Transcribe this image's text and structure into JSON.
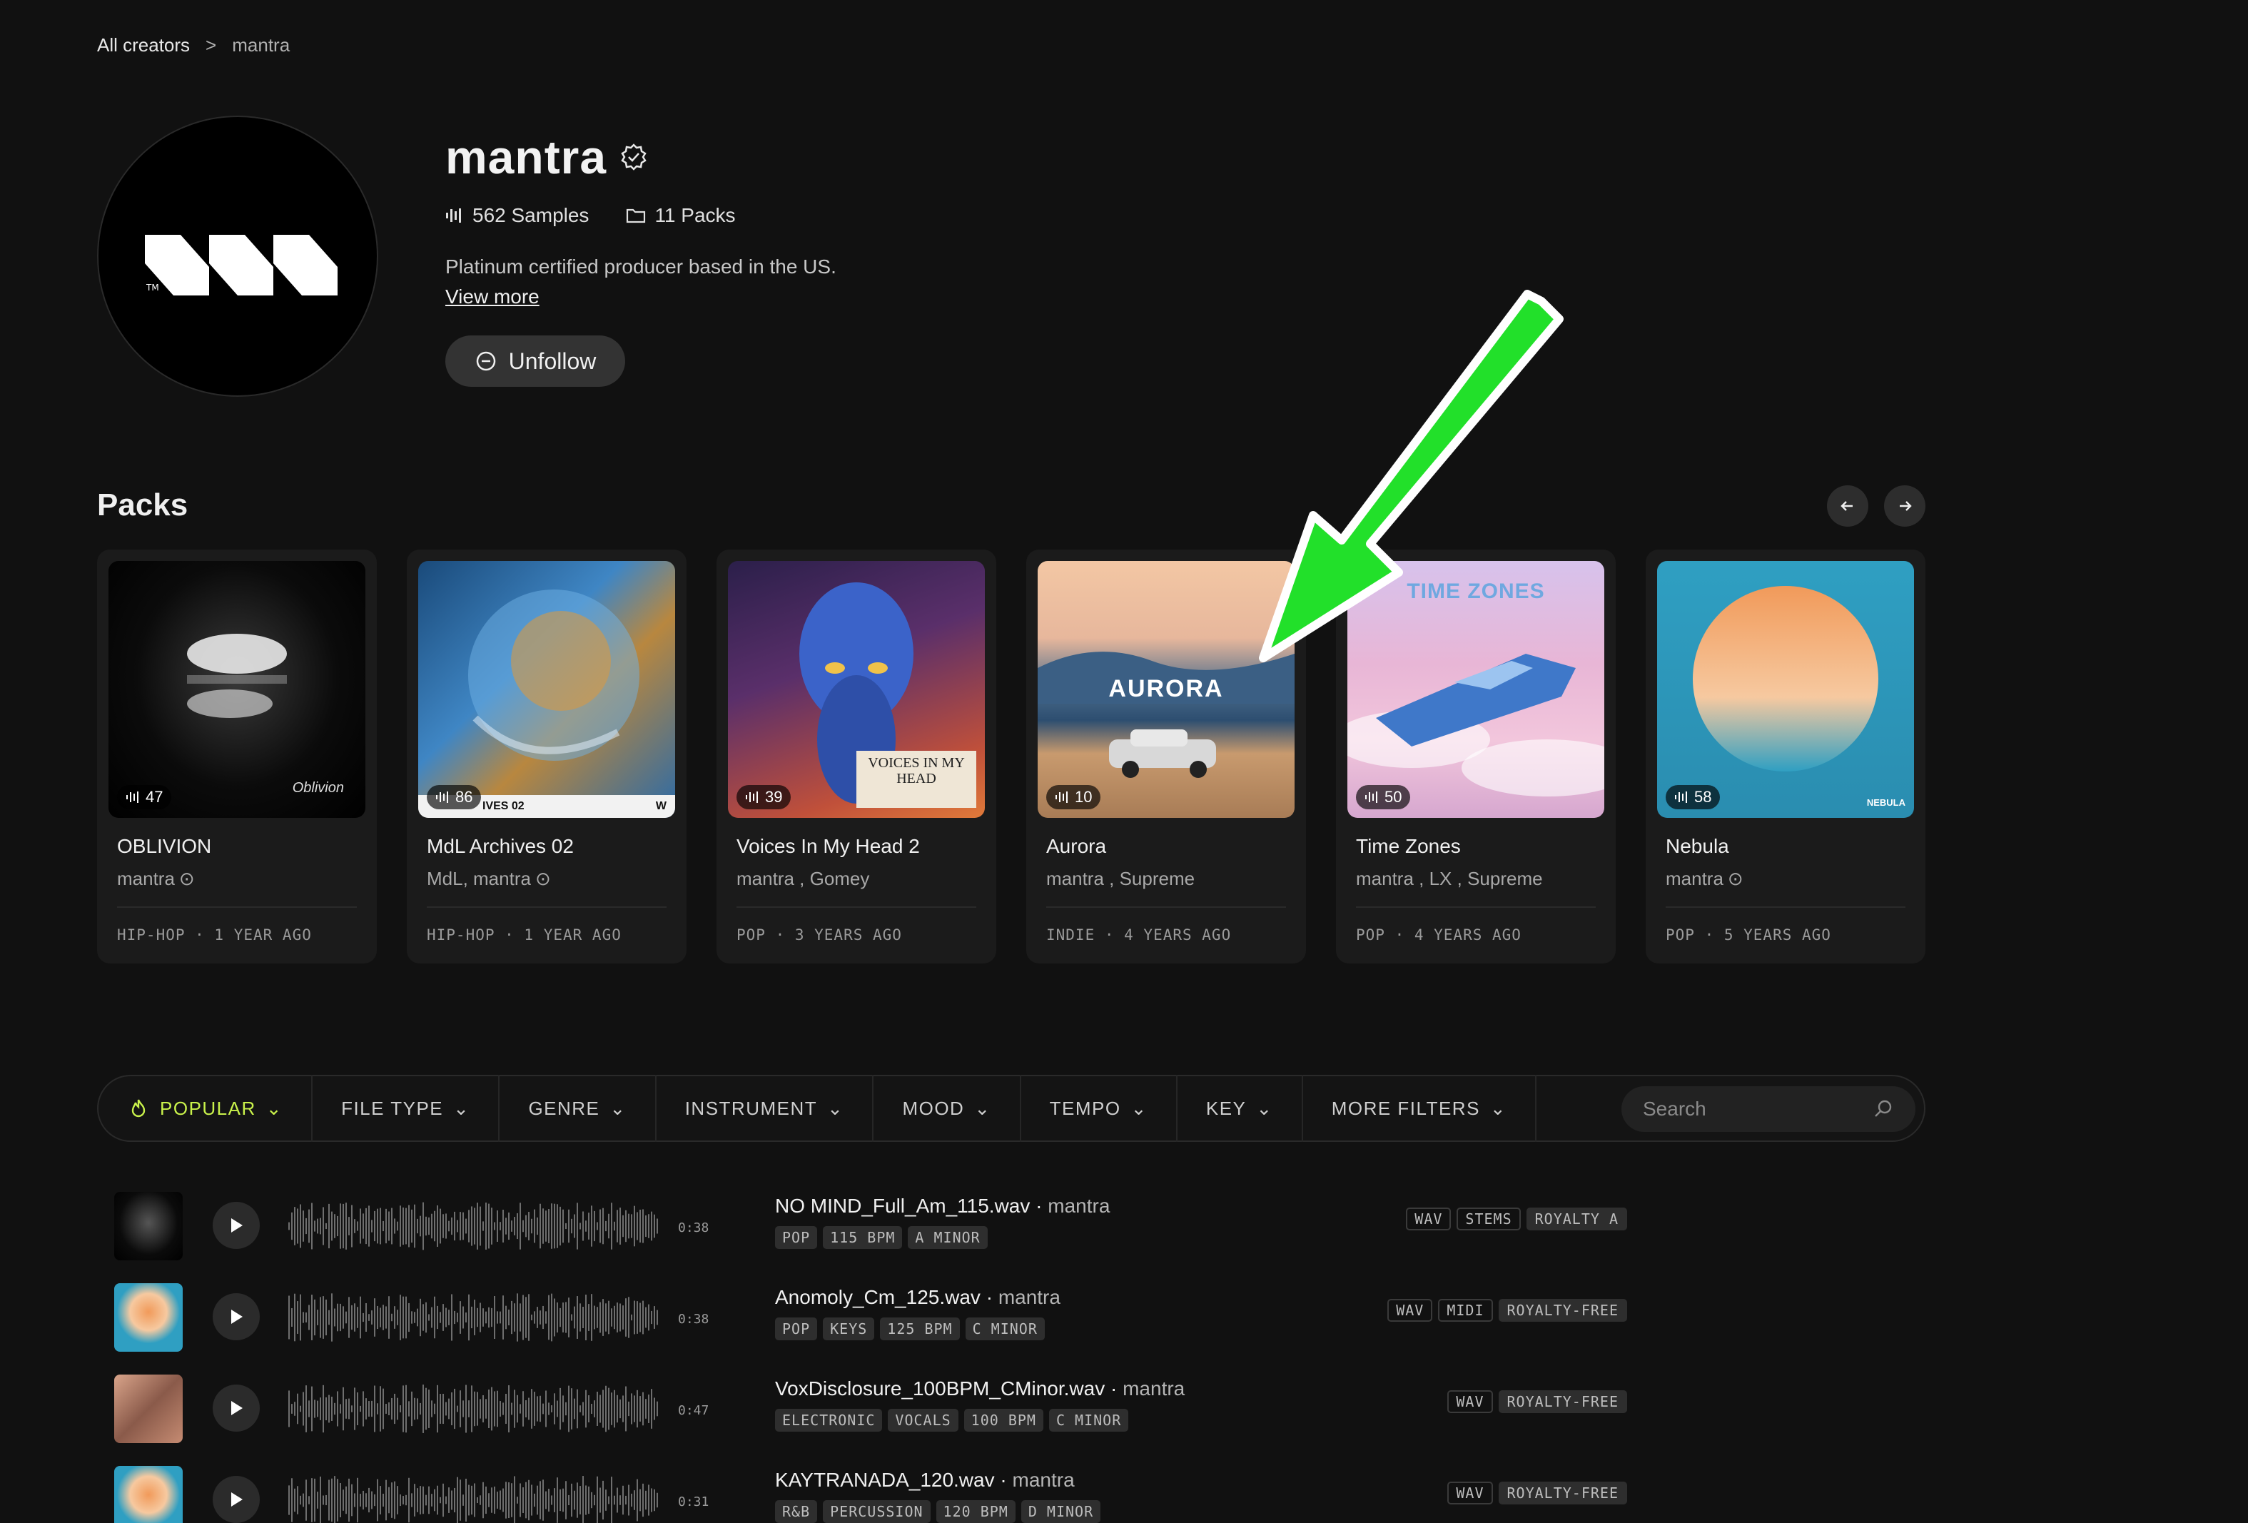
{
  "breadcrumb": {
    "root": "All creators",
    "separator": ">",
    "current": "mantra"
  },
  "profile": {
    "name": "mantra",
    "samples": "562 Samples",
    "packs": "11 Packs",
    "bio": "Platinum certified producer based in the US.",
    "view_more": "View more",
    "unfollow_label": "Unfollow"
  },
  "packs_section": {
    "title": "Packs",
    "items": [
      {
        "count": "47",
        "title": "OBLIVION",
        "artists": "mantra",
        "meta": "HIP-HOP · 1 YEAR AGO",
        "cover_text": "Oblivion"
      },
      {
        "count": "86",
        "title": "MdL Archives 02",
        "artists": "MdL, mantra",
        "meta": "HIP-HOP · 1 YEAR AGO",
        "cover_text": "IVES 02"
      },
      {
        "count": "39",
        "title": "Voices In My Head 2",
        "artists": "mantra , Gomey",
        "meta": "POP · 3 YEARS AGO",
        "cover_text": "VOICES IN MY HEAD"
      },
      {
        "count": "10",
        "title": "Aurora",
        "artists": "mantra , Supreme",
        "meta": "INDIE · 4 YEARS AGO",
        "cover_text": "AURORA"
      },
      {
        "count": "50",
        "title": "Time Zones",
        "artists": "mantra , LX , Supreme",
        "meta": "POP · 4 YEARS AGO",
        "cover_text": "TIME ZONES"
      },
      {
        "count": "58",
        "title": "Nebula",
        "artists": "mantra",
        "meta": "POP · 5 YEARS AGO",
        "cover_text": "NEBULA"
      }
    ]
  },
  "filters": {
    "popular": "POPULAR",
    "file_type": "FILE TYPE",
    "genre": "GENRE",
    "instrument": "INSTRUMENT",
    "mood": "MOOD",
    "tempo": "TEMPO",
    "key": "KEY",
    "more": "MORE FILTERS",
    "search_placeholder": "Search"
  },
  "tracks": [
    {
      "name": "NO MIND_Full_Am_115.wav",
      "artist": "mantra",
      "duration": "0:38",
      "tags": [
        "POP",
        "115 BPM",
        "A MINOR"
      ],
      "formats": [
        "WAV",
        "STEMS",
        "ROYALTY A"
      ]
    },
    {
      "name": "Anomoly_Cm_125.wav",
      "artist": "mantra",
      "duration": "0:38",
      "tags": [
        "POP",
        "KEYS",
        "125 BPM",
        "C MINOR"
      ],
      "formats": [
        "WAV",
        "MIDI",
        "ROYALTY-FREE"
      ]
    },
    {
      "name": "VoxDisclosure_100BPM_CMinor.wav",
      "artist": "mantra",
      "duration": "0:47",
      "tags": [
        "ELECTRONIC",
        "VOCALS",
        "100 BPM",
        "C MINOR"
      ],
      "formats": [
        "WAV",
        "ROYALTY-FREE"
      ]
    },
    {
      "name": "KAYTRANADA_120.wav",
      "artist": "mantra",
      "duration": "0:31",
      "tags": [
        "R&B",
        "PERCUSSION",
        "120 BPM",
        "D MINOR"
      ],
      "formats": [
        "WAV",
        "ROYALTY-FREE"
      ]
    }
  ],
  "colors": {
    "accent": "#c9f24b",
    "annotation_arrow": "#22e02a"
  }
}
